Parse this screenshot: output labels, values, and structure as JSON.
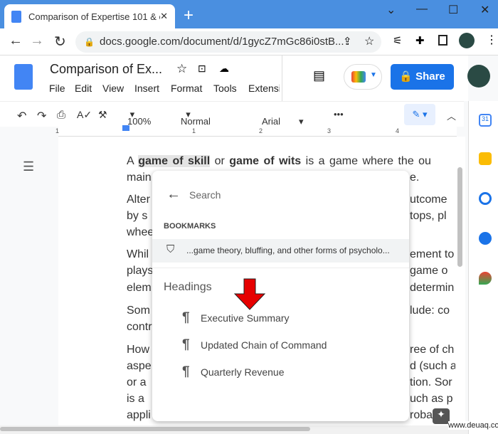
{
  "browser": {
    "tab_title": "Comparison of Expertise 101 & e",
    "url": "docs.google.com/document/d/1gycZ7mGc86i0stB..."
  },
  "doc": {
    "title": "Comparison of Ex...",
    "menu": [
      "File",
      "Edit",
      "View",
      "Insert",
      "Format",
      "Tools",
      "Extensi"
    ],
    "share_label": "Share"
  },
  "toolbar": {
    "zoom": "100%",
    "style": "Normal text",
    "font": "Arial"
  },
  "ruler": [
    "1",
    "1",
    "2",
    "3",
    "4"
  ],
  "body": {
    "line1": [
      {
        "t": "A ",
        "b": false
      },
      {
        "t": "game of skill",
        "b": true
      },
      {
        "t": " or ",
        "b": false
      },
      {
        "t": "game of wits",
        "b": true
      },
      {
        "t": " is a game where the ou",
        "b": false
      }
    ],
    "left": [
      "main",
      "Alter",
      "by s",
      "whee",
      "Whil",
      "plays",
      "elem",
      "Som",
      "contr",
      "How",
      "aspe",
      "or a",
      "is a",
      "appli"
    ],
    "right": [
      "e.",
      "utcome",
      "tops, pl",
      "",
      "ement to",
      "game o",
      "determin",
      "lude: co",
      "",
      "ree of ch",
      "d (such a",
      "tion. Sor",
      "uch as p",
      "robal"
    ]
  },
  "popup": {
    "search_placeholder": "Search",
    "bookmarks_label": "BOOKMARKS",
    "bookmark": "...game theory, bluffing, and other forms of psycholo...",
    "headings_label": "Headings",
    "headings": [
      "Executive Summary",
      "Updated Chain of Command",
      "Quarterly Revenue"
    ]
  },
  "annotation": {
    "arrow_color": "#e60000"
  },
  "watermark": "www.deuaq.com",
  "colors": {
    "accent": "#1a73e8",
    "tabbar": "#4a8fe0"
  }
}
